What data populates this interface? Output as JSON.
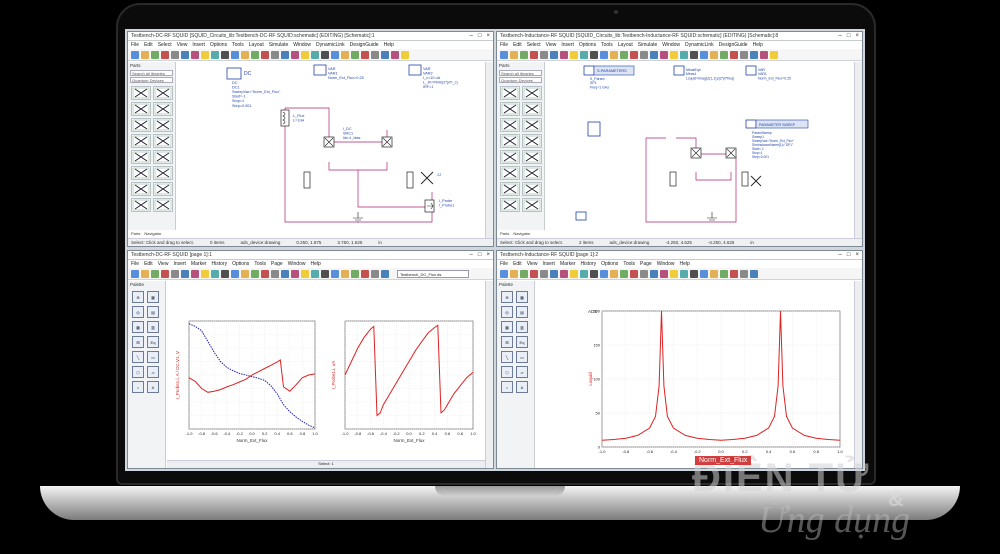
{
  "windows": {
    "schem_dc": {
      "title": "Testbench-DC-RF SQUID [SQUID_Circuits_lib:Testbench-DC-RF SQUID:schematic] (EDITING) [Schematic]:1",
      "menu": [
        "File",
        "Edit",
        "Select",
        "View",
        "Insert",
        "Options",
        "Tools",
        "Layout",
        "Simulate",
        "Window",
        "DynamicLink",
        "DesignGuide",
        "Help"
      ],
      "parts_header": "Parts",
      "parts_search": "Search all libraries",
      "parts_library": "Quantum Devices",
      "tabs": [
        "Parts",
        "Navigator"
      ],
      "status": {
        "hint": "Select: Click and drag to select.",
        "items": "0 items",
        "layer": "ads_device:drawing",
        "coord1": "0.250, 1.875",
        "coord2": "3.750, 1.625",
        "unit": "in"
      },
      "blocks": {
        "dc_title": "DC",
        "dc_lines": [
          "DC",
          "DC1",
          "SweepVar=\"Norm_Ext_Flux\"",
          "Start=-1",
          "Stop=1",
          "Step=0.001"
        ],
        "var1_title": "VAR",
        "var1_lines": [
          "VAR",
          "VAR1",
          "Norm_Ext_Flux=0.25"
        ],
        "var2_title": "VAR",
        "var2_lines": [
          "VAR",
          "VAR2",
          "I_c=10 uA",
          "L_J0=Phi0/(2*pi*I_c)",
          "IRF=1"
        ],
        "isrc_lines": [
          "I_DC",
          "SRC1",
          "Idc=I_bias"
        ],
        "jj_label": "JJ",
        "probe_lines": [
          "I_Probe",
          "I_Probe1"
        ],
        "ind_lines": [
          "L_Flux",
          "L=1nH"
        ]
      }
    },
    "schem_rf": {
      "title": "Testbench-Inductance-RF SQUID [SQUID_Circuits_lib:Testbench-Inductance-RF SQUID:schematic] (EDITING) [Schematic]:8",
      "menu": [
        "File",
        "Edit",
        "Select",
        "View",
        "Insert",
        "Options",
        "Tools",
        "Layout",
        "Simulate",
        "Window",
        "DynamicLink",
        "DesignGuide",
        "Help"
      ],
      "parts_header": "Parts",
      "parts_search": "Search all libraries",
      "parts_library": "Quantum Devices",
      "tabs": [
        "Parts",
        "Navigator"
      ],
      "status": {
        "hint": "Select: Click and drag to select.",
        "items": "2 items",
        "layer": "ads_device:drawing",
        "coord1": "-4.250, 4.625",
        "coord2": "-4.250, 4.625",
        "unit": "in"
      },
      "blocks": {
        "sp_title": "S-PARAMETERS",
        "sp_lines": [
          "S_Param",
          "SP1",
          "Freq=1 GHz"
        ],
        "sweep_title": "PARAMETER SWEEP",
        "sweep_lines": [
          "ParamSweep",
          "Sweep1",
          "SweepVar=\"Norm_Ext_Flux\"",
          "SimInstanceName[1]=\"SP1\"",
          "Start=-1",
          "Stop=1",
          "Step=0.001"
        ],
        "eqn_lines": [
          "MeasEqn",
          "Meas1",
          "Lsquid=imag(Z(1,1))/(2*pi*freq)"
        ],
        "var_lines": [
          "VAR",
          "VAR1",
          "Norm_Ext_Flux=0.25"
        ]
      }
    },
    "plot_dc": {
      "title": "Testbench-DC-RF SQUID [page 1]:1",
      "menu": [
        "File",
        "Edit",
        "View",
        "Insert",
        "Marker",
        "History",
        "Options",
        "Tools",
        "Page",
        "Window",
        "Help"
      ],
      "dataset": "Testbench_DC_Flux.ds",
      "palette_header": "Palette",
      "status": "Select: 1"
    },
    "plot_rf": {
      "title": "Testbench-Inductance-RF SQUID [page 1]:2",
      "menu": [
        "File",
        "Edit",
        "View",
        "Insert",
        "Marker",
        "History",
        "Options",
        "Tools",
        "Page",
        "Window",
        "Help"
      ],
      "palette_header": "Palette"
    }
  },
  "chart_data": [
    {
      "type": "line",
      "name": "left plot",
      "xlabel": "Norm_Ext_Flux",
      "ylabel": "I_Probe1.i, A / DC.V1, V",
      "xlim": [
        -1.0,
        1.0
      ],
      "ylim": [
        -1.0,
        1.0
      ],
      "xticks": [
        "-1.0",
        "-0.8",
        "-0.6",
        "-0.4",
        "-0.2",
        "0.0",
        "0.2",
        "0.4",
        "0.6",
        "0.8",
        "1.0"
      ],
      "series": [
        {
          "name": "I_Probe1.i",
          "color": "#d22",
          "style": "solid",
          "x": [
            -1.0,
            -0.9,
            -0.8,
            -0.7,
            -0.6,
            -0.5,
            -0.4,
            -0.3,
            -0.2,
            -0.1,
            0.0,
            0.1,
            0.2,
            0.3,
            0.4,
            0.45,
            0.5,
            0.6,
            0.7,
            0.8,
            0.9,
            1.0
          ],
          "y": [
            -0.05,
            -0.12,
            -0.25,
            -0.32,
            -0.3,
            -0.27,
            -0.22,
            -0.18,
            -0.13,
            -0.08,
            0.0,
            0.06,
            0.12,
            0.18,
            0.24,
            0.28,
            -0.22,
            -0.3,
            -0.18,
            -0.05,
            0.0,
            0.02
          ]
        },
        {
          "name": "DC.V1",
          "color": "#22a",
          "style": "dashed",
          "x": [
            -1.0,
            -0.9,
            -0.8,
            -0.7,
            -0.6,
            -0.5,
            -0.4,
            -0.3,
            -0.2,
            -0.1,
            0.0,
            0.1,
            0.2,
            0.3,
            0.4,
            0.5,
            0.6,
            0.7,
            0.8,
            0.9,
            1.0
          ],
          "y": [
            0.95,
            0.9,
            0.82,
            0.62,
            0.42,
            0.25,
            0.14,
            0.08,
            0.03,
            0.0,
            -0.03,
            -0.06,
            -0.1,
            -0.2,
            -0.35,
            -0.55,
            -0.68,
            -0.78,
            -0.86,
            -0.93,
            -0.98
          ]
        }
      ]
    },
    {
      "type": "line",
      "name": "middle plot",
      "xlabel": "Norm_Ext_Flux",
      "ylabel": "I_Probe1.i, uA",
      "xlim": [
        -1.0,
        1.0
      ],
      "ylim": [
        -1.0,
        1.0
      ],
      "xticks": [
        "-1.0",
        "-0.8",
        "-0.6",
        "-0.4",
        "-0.2",
        "0.0",
        "0.2",
        "0.4",
        "0.6",
        "0.8",
        "1.0"
      ],
      "series": [
        {
          "name": "I_Probe1.i",
          "color": "#d22",
          "style": "solid",
          "x": [
            -1.0,
            -0.9,
            -0.8,
            -0.7,
            -0.6,
            -0.55,
            -0.5,
            -0.45,
            -0.4,
            -0.3,
            -0.2,
            -0.1,
            0.0,
            0.1,
            0.2,
            0.3,
            0.4,
            0.45,
            0.5,
            0.55,
            0.6,
            0.7,
            0.8,
            0.9,
            1.0
          ],
          "y": [
            0.0,
            0.25,
            0.5,
            0.7,
            0.85,
            0.9,
            -0.75,
            -0.7,
            -0.55,
            -0.35,
            -0.15,
            0.05,
            0.25,
            0.45,
            0.62,
            0.78,
            0.88,
            0.92,
            -0.7,
            -0.65,
            -0.55,
            -0.35,
            -0.2,
            -0.05,
            0.05
          ]
        }
      ]
    },
    {
      "type": "line",
      "name": "right plot",
      "xlabel": "Norm_Ext_Flux",
      "ylabel": "Lsquid",
      "title": "ADS",
      "xlim": [
        -1.0,
        1.0
      ],
      "ylim": [
        0,
        200
      ],
      "xticks": [
        "-1.0",
        "-0.8",
        "-0.6",
        "-0.4",
        "-0.2",
        "0.0",
        "0.2",
        "0.4",
        "0.6",
        "0.8",
        "1.0"
      ],
      "yticks": [
        "0",
        "50",
        "100",
        "150",
        "200"
      ],
      "series": [
        {
          "name": "Lsquid",
          "color": "#d22",
          "style": "solid",
          "x": [
            -1.0,
            -0.9,
            -0.8,
            -0.7,
            -0.6,
            -0.55,
            -0.52,
            -0.5,
            -0.48,
            -0.45,
            -0.4,
            -0.3,
            -0.2,
            -0.1,
            0.0,
            0.1,
            0.2,
            0.3,
            0.4,
            0.45,
            0.48,
            0.5,
            0.52,
            0.55,
            0.6,
            0.7,
            0.8,
            0.9,
            1.0
          ],
          "y": [
            10,
            11,
            13,
            17,
            28,
            45,
            90,
            200,
            90,
            45,
            28,
            17,
            13,
            11,
            10,
            11,
            13,
            17,
            28,
            45,
            90,
            200,
            90,
            45,
            28,
            17,
            13,
            11,
            10
          ]
        }
      ]
    }
  ],
  "watermark": {
    "line1": "ĐIỆN TỬ",
    "line2": "Ứng dụng",
    "amp": "&",
    "tag": "Norm_Ext_Flux"
  },
  "colors": {
    "accent": "#c0227a",
    "plot_red": "#d22",
    "plot_blue": "#22a"
  }
}
